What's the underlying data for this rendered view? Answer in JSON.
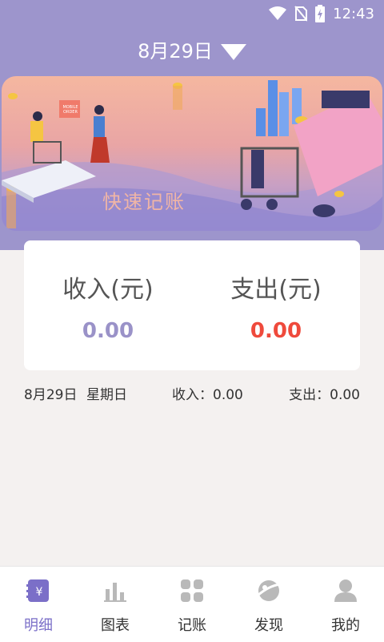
{
  "status": {
    "time": "12:43"
  },
  "header": {
    "date": "8月29日"
  },
  "banner": {
    "title": "快速记账",
    "sign_text": "MOBILE ORDER"
  },
  "totals": {
    "income_label": "收入(元)",
    "income_value": "0.00",
    "expense_label": "支出(元)",
    "expense_value": "0.00"
  },
  "day_summary": {
    "date": "8月29日",
    "weekday": "星期日",
    "income": "收入：0.00",
    "expense": "支出：0.00"
  },
  "tabs": [
    {
      "label": "明细",
      "icon": "ledger-icon"
    },
    {
      "label": "图表",
      "icon": "bar-chart-icon"
    },
    {
      "label": "记账",
      "icon": "grid-icon"
    },
    {
      "label": "发现",
      "icon": "planet-icon"
    },
    {
      "label": "我的",
      "icon": "user-icon"
    }
  ],
  "colors": {
    "header_bg": "#9d95cc",
    "income": "#9a92c8",
    "expense": "#ef4a3c",
    "tab_active": "#7b6fc8",
    "tab_inactive": "#b9b9b9"
  }
}
